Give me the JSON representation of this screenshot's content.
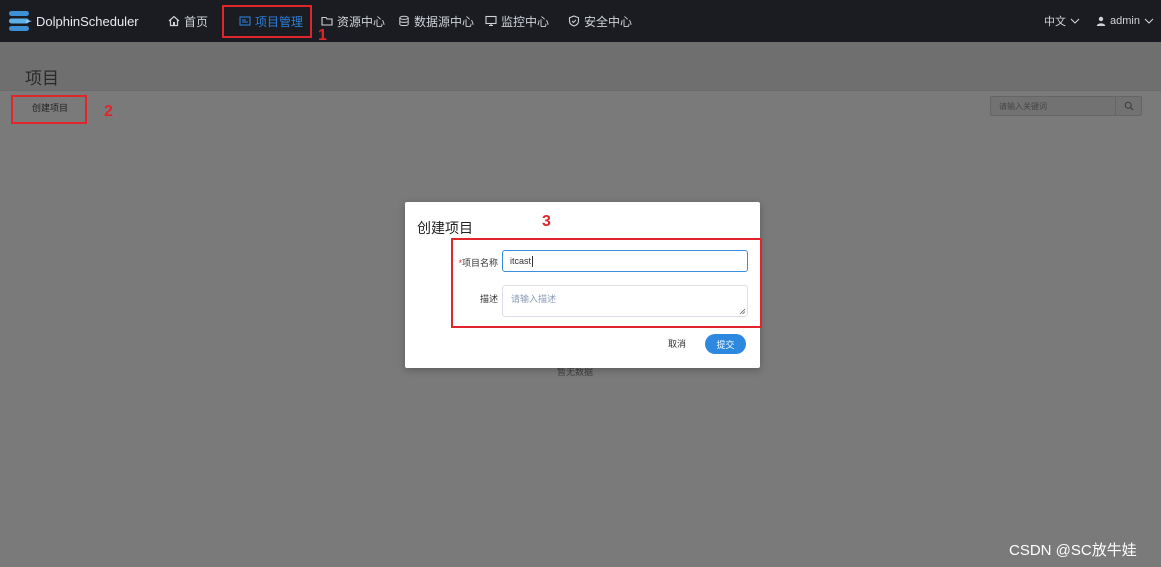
{
  "app": {
    "name": "DolphinScheduler"
  },
  "nav": {
    "items": [
      {
        "label": "首页",
        "icon": "home-icon"
      },
      {
        "label": "项目管理",
        "icon": "project-icon"
      },
      {
        "label": "资源中心",
        "icon": "folder-icon"
      },
      {
        "label": "数据源中心",
        "icon": "database-icon"
      },
      {
        "label": "监控中心",
        "icon": "monitor-icon"
      },
      {
        "label": "安全中心",
        "icon": "shield-icon"
      }
    ],
    "language": "中文",
    "user": "admin",
    "active_color": "#2d7fd8"
  },
  "page": {
    "title": "项目",
    "create_button": "创建项目",
    "search_placeholder": "请输入关键词",
    "empty_text": "暂无数据"
  },
  "modal": {
    "title": "创建项目",
    "name_label": "项目名称",
    "required_mark": "*",
    "name_value": "itcast",
    "desc_label": "描述",
    "desc_placeholder": "请输入描述",
    "cancel": "取消",
    "submit": "提交"
  },
  "annotations": {
    "label_1": "1",
    "label_2": "2",
    "label_3": "3",
    "color": "#e0262a"
  },
  "watermark": "CSDN @SC放牛娃"
}
